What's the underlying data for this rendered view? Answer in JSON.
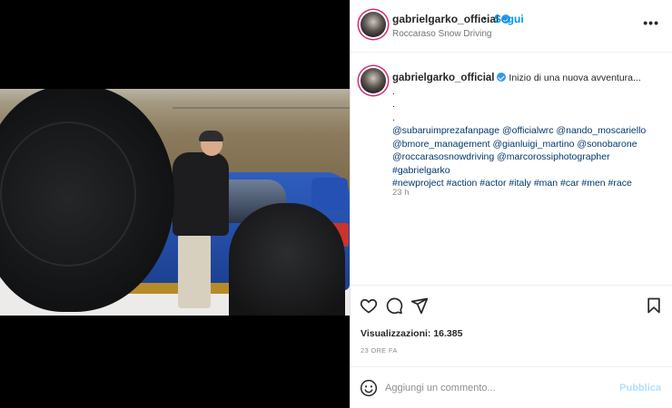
{
  "header": {
    "username": "gabrielgarko_official",
    "separator": "•",
    "follow_label": "Segui",
    "location": "Roccaraso Snow Driving",
    "more_icon": "more-horizontal-icon"
  },
  "caption": {
    "username": "gabrielgarko_official",
    "first_line": "Inizio di una nuova avventura...",
    "dots": [
      ".",
      ".",
      "."
    ],
    "mention_lines": [
      "@subaruimprezafanpage @officialwrc @nando_moscariello",
      "@bmore_management @gianluigi_martino @sonobarone",
      "@roccarasosnowdriving @marcorossiphotographer #gabrielgarko",
      "#newproject #action #actor #italy #man #car #men #race"
    ],
    "time": "23 h"
  },
  "actions": {
    "like_icon": "heart-icon",
    "comment_icon": "comment-bubble-icon",
    "share_icon": "paper-plane-icon",
    "save_icon": "bookmark-icon"
  },
  "stats": {
    "views": "Visualizzazioni: 16.385",
    "ago": "23 ORE FA"
  },
  "comment_box": {
    "emoji_icon": "emoji-icon",
    "placeholder": "Aggiungi un commento...",
    "publish_label": "Pubblica"
  },
  "colors": {
    "accent": "#0095f6",
    "verified": "#3897f0",
    "publish_disabled": "#b2dffc"
  }
}
